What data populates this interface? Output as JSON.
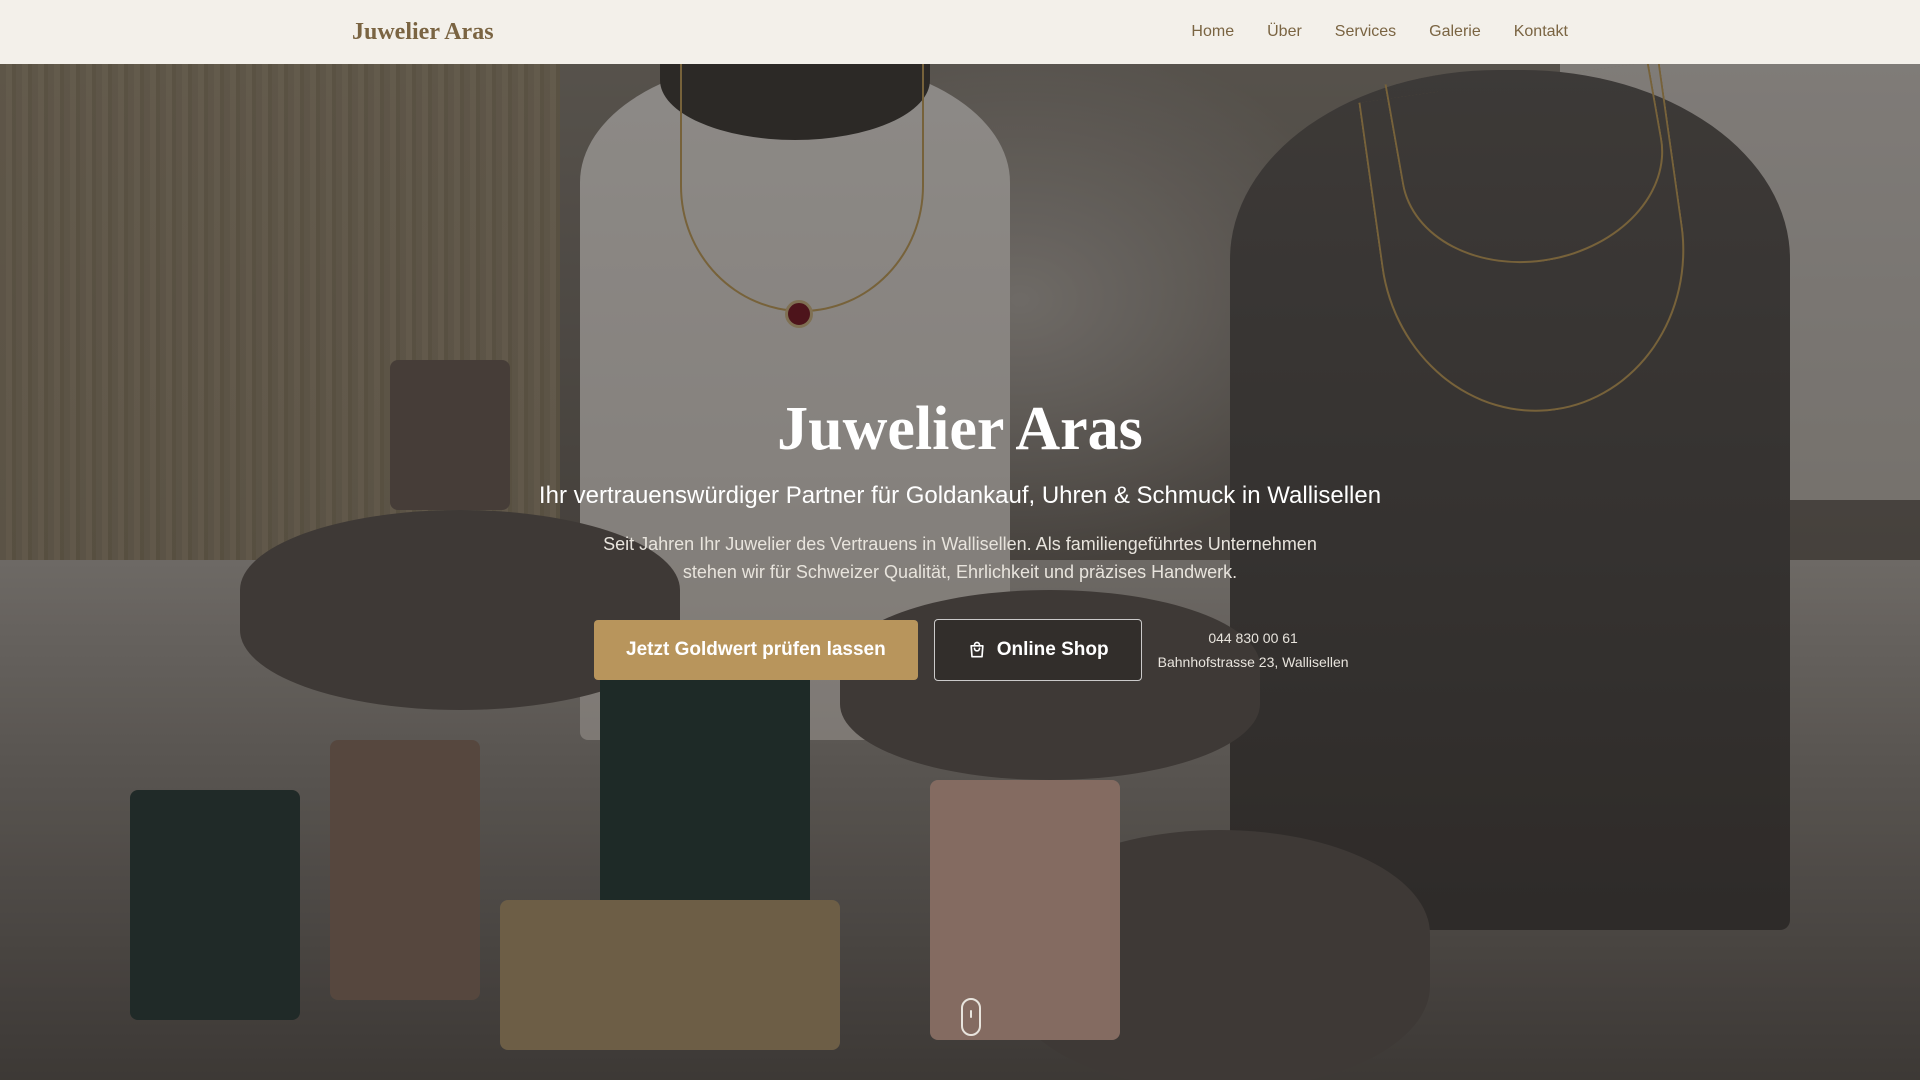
{
  "navbar": {
    "brand": "Juwelier Aras",
    "links": [
      "Home",
      "Über",
      "Services",
      "Galerie",
      "Kontakt"
    ]
  },
  "hero": {
    "title": "Juwelier Aras",
    "subtitle": "Ihr vertrauenswürdiger Partner für Goldankauf, Uhren & Schmuck in Wallisellen",
    "description": "Seit Jahren Ihr Juwelier des Vertrauens in Wallisellen. Als familiengeführtes Unternehmen stehen wir für Schweizer Qualität, Ehrlichkeit und präzises Handwerk.",
    "primary_button": "Jetzt Goldwert prüfen lassen",
    "secondary_button": "Online Shop",
    "secondary_button_icon": "shopping-bag-icon",
    "phone": "044 830 00 61",
    "address": "Bahnhofstrasse 23, Wallisellen"
  },
  "colors": {
    "brand": "#7a6442",
    "accent": "#b8955c",
    "navbar_bg": "#f3f0ea"
  }
}
